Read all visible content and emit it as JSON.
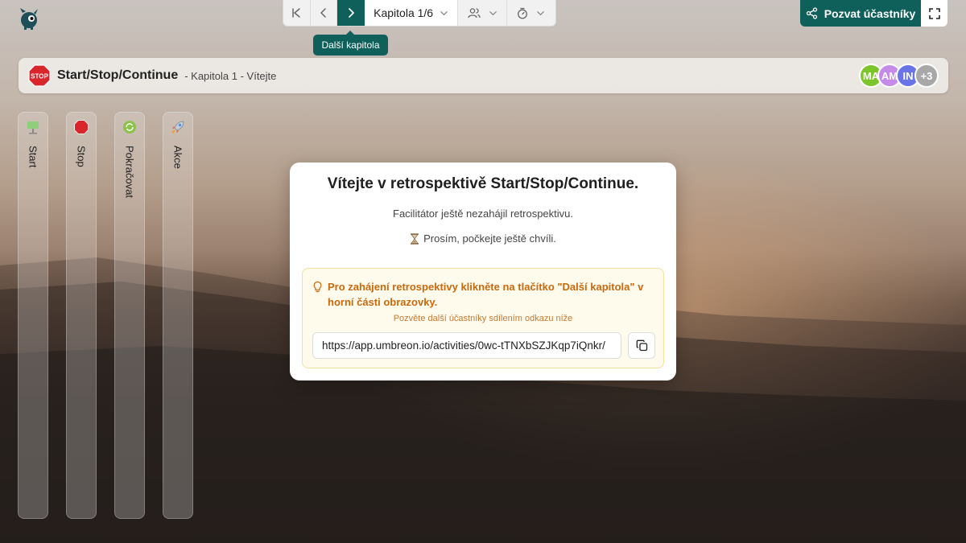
{
  "toolbar": {
    "chapter_label": "Kapitola 1/6",
    "tooltip": "Další kapitola"
  },
  "invite": {
    "label": "Pozvat účastníky"
  },
  "header": {
    "title": "Start/Stop/Continue",
    "subtitle": "- Kapitola 1 - Vítejte",
    "avatars": [
      {
        "initials": "MA",
        "color": "#7cc62b"
      },
      {
        "initials": "AM",
        "color": "#c58be8"
      },
      {
        "initials": "IN",
        "color": "#6b74e6"
      },
      {
        "initials": "+3",
        "color": "#a8a8a8"
      }
    ]
  },
  "columns": [
    {
      "label": "Start"
    },
    {
      "label": "Stop"
    },
    {
      "label": "Pokračovat"
    },
    {
      "label": "Akce"
    }
  ],
  "modal": {
    "title": "Vítejte v retrospektivě Start/Stop/Continue.",
    "text1": "Facilitátor ještě nezahájil retrospektivu.",
    "text2": "Prosím, počkejte ještě chvíli.",
    "notice": "Pro zahájení retrospektivy klikněte na tlačítko \"Další kapitola\" v horní části obrazovky.",
    "hint": "Pozvěte další účastníky sdílením odkazu níže",
    "url": "https://app.umbreon.io/activities/0wc-tTNXbSZJKqp7iQnkr/"
  },
  "colors": {
    "accent": "#0f5f5a",
    "notice_text": "#c9690d"
  }
}
